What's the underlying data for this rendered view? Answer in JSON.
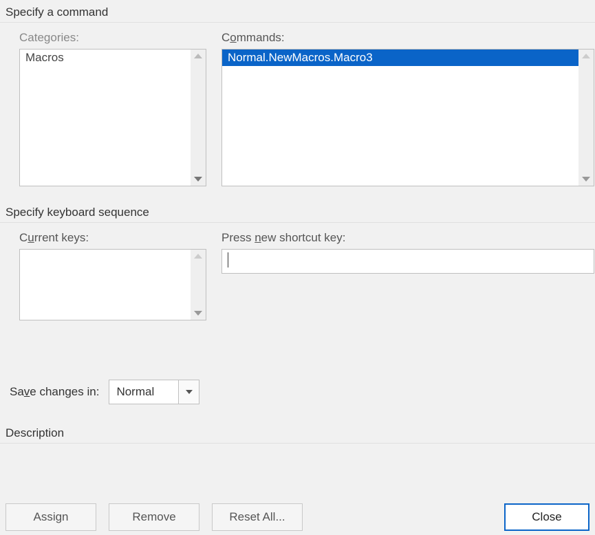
{
  "sections": {
    "specify_command": "Specify a command",
    "specify_sequence": "Specify keyboard sequence",
    "description": "Description"
  },
  "labels": {
    "categories": "Categories:",
    "commands_pre": "C",
    "commands_u": "o",
    "commands_post": "mmands:",
    "current_keys_pre": "C",
    "current_keys_u": "u",
    "current_keys_post": "rrent keys:",
    "press_pre": "Press ",
    "press_u": "n",
    "press_post": "ew shortcut key:",
    "save_pre": "Sa",
    "save_u": "v",
    "save_post": "e changes in:"
  },
  "categories": {
    "items": [
      "Macros"
    ],
    "selected_index": 0
  },
  "commands": {
    "items": [
      "Normal.NewMacros.Macro3"
    ],
    "selected_index": 0
  },
  "current_keys": {
    "items": []
  },
  "new_shortcut": {
    "value": ""
  },
  "save_in": {
    "value": "Normal"
  },
  "buttons": {
    "assign": "Assign",
    "remove": "Remove",
    "reset_all": "Reset All...",
    "close": "Close"
  }
}
